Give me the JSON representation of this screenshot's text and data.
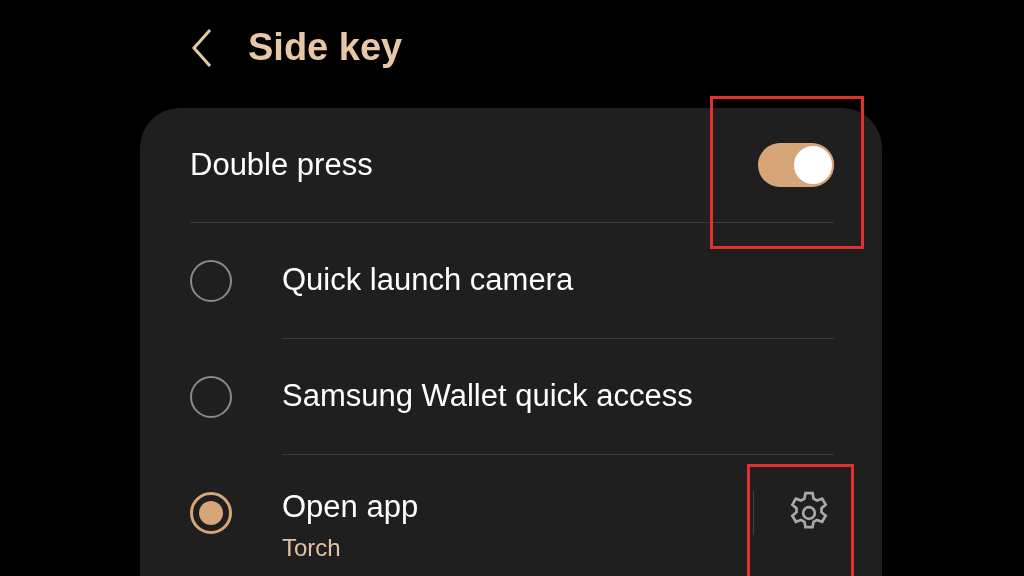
{
  "header": {
    "title": "Side key"
  },
  "toggle_row": {
    "label": "Double press",
    "on": true,
    "highlighted": true
  },
  "options": [
    {
      "label": "Quick launch camera",
      "selected": false
    },
    {
      "label": "Samsung Wallet quick access",
      "selected": false
    },
    {
      "label": "Open app",
      "subtitle": "Torch",
      "selected": true,
      "settings_highlighted": true
    }
  ]
}
